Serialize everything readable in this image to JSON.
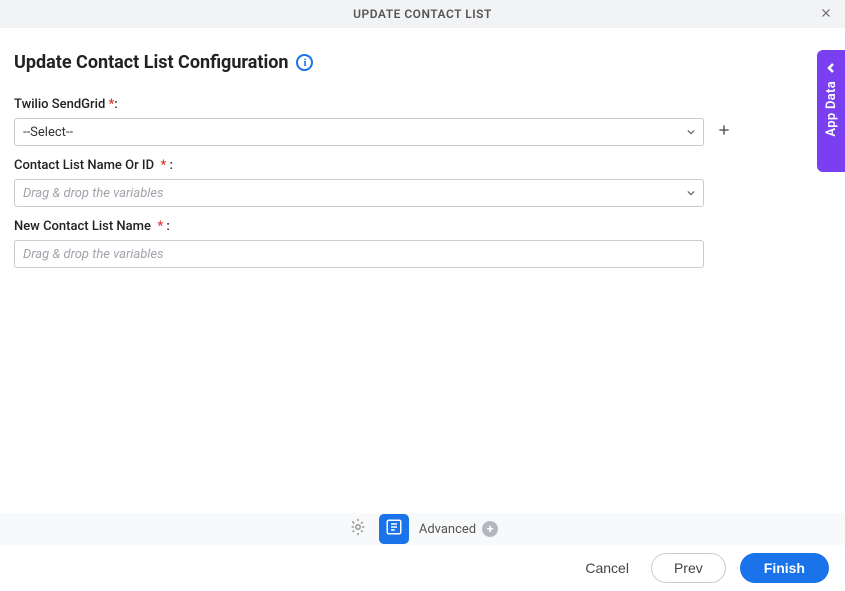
{
  "header": {
    "title": "UPDATE CONTACT LIST"
  },
  "page": {
    "title": "Update Contact List Configuration"
  },
  "fields": {
    "sendgrid": {
      "label": "Twilio SendGrid",
      "value": "--Select--"
    },
    "contactListId": {
      "label": "Contact List Name Or ID",
      "placeholder": "Drag & drop the variables"
    },
    "newName": {
      "label": "New Contact List Name",
      "placeholder": "Drag & drop the variables"
    }
  },
  "sidebar": {
    "app_data_label": "App Data"
  },
  "toolbar": {
    "advanced_label": "Advanced"
  },
  "footer": {
    "cancel": "Cancel",
    "prev": "Prev",
    "finish": "Finish"
  }
}
